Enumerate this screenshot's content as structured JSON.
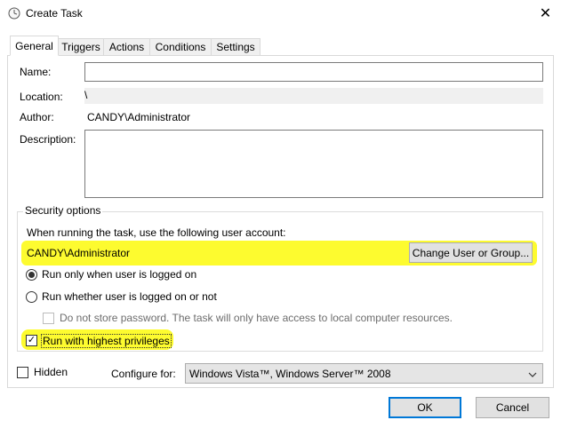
{
  "window": {
    "title": "Create Task",
    "icon": "task-scheduler-clock-icon"
  },
  "tabs": [
    {
      "label": "General",
      "active": true
    },
    {
      "label": "Triggers",
      "active": false
    },
    {
      "label": "Actions",
      "active": false
    },
    {
      "label": "Conditions",
      "active": false
    },
    {
      "label": "Settings",
      "active": false
    }
  ],
  "general": {
    "name_label": "Name:",
    "name_value": "",
    "location_label": "Location:",
    "location_value": "\\",
    "author_label": "Author:",
    "author_value": "CANDY\\Administrator",
    "description_label": "Description:",
    "description_value": ""
  },
  "security": {
    "group_title": "Security options",
    "account_prompt": "When running the task, use the following user account:",
    "account_value": "CANDY\\Administrator",
    "change_button": "Change User or Group...",
    "radio_logged_on": "Run only when user is logged on",
    "radio_logged_on_selected": true,
    "radio_whether": "Run whether user is logged on or not",
    "radio_whether_selected": false,
    "no_store_password": "Do not store password.  The task will only have access to local computer resources.",
    "no_store_password_checked": false,
    "highest_privileges": "Run with highest privileges",
    "highest_privileges_checked": true
  },
  "bottom": {
    "hidden_label": "Hidden",
    "hidden_checked": false,
    "configure_label": "Configure for:",
    "configure_value": "Windows Vista™, Windows Server™ 2008"
  },
  "buttons": {
    "ok": "OK",
    "cancel": "Cancel"
  },
  "colors": {
    "highlight": "#fdfb2f",
    "accent_border": "#0078d7"
  }
}
